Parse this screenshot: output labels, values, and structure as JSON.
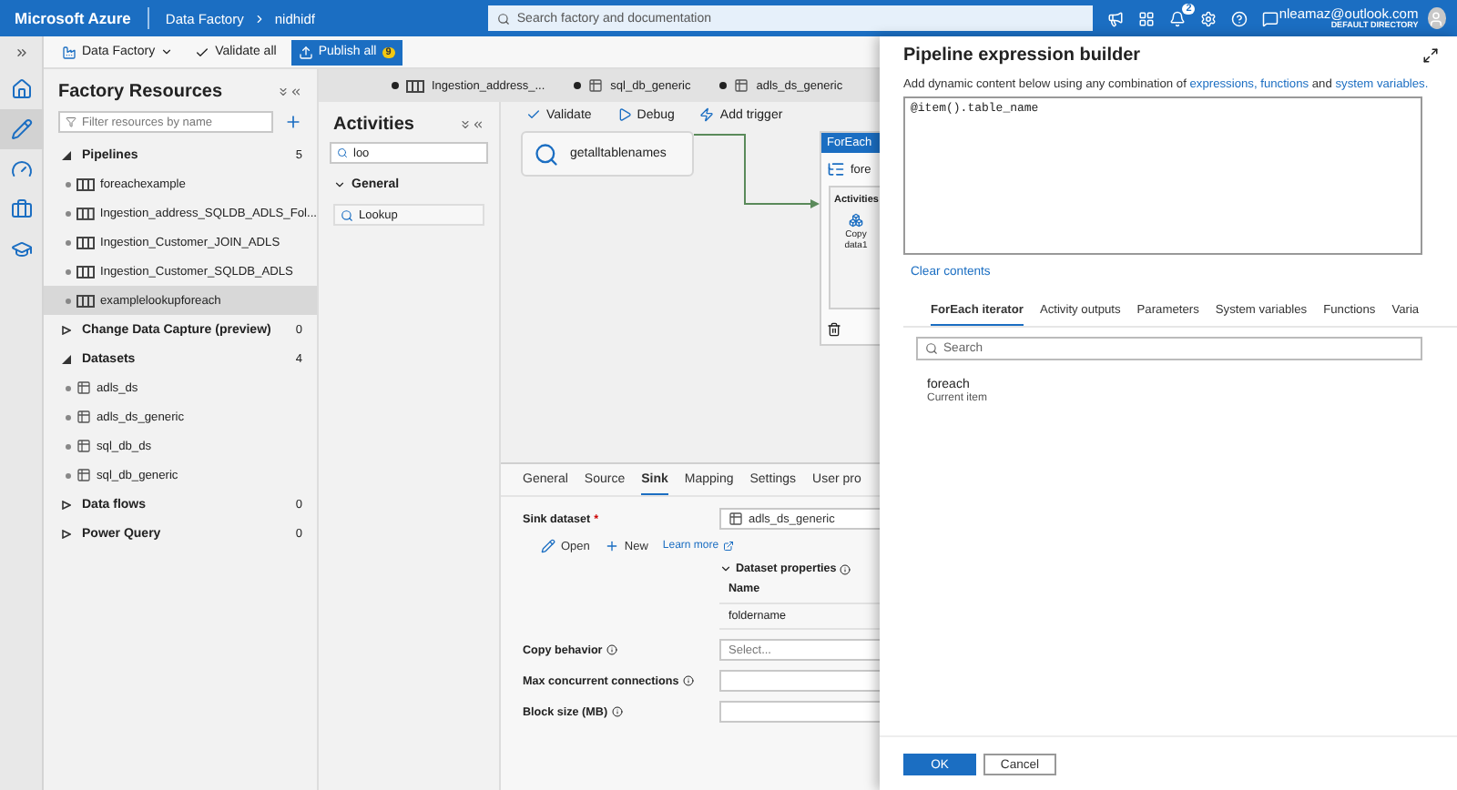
{
  "topbar": {
    "brand": "Microsoft Azure",
    "breadcrumb": [
      "Data Factory",
      "nidhidf"
    ],
    "search": {
      "placeholder": "Search factory and documentation"
    },
    "notification_count": "2",
    "user": {
      "email": "nleamaz@outlook.com",
      "directory": "DEFAULT DIRECTORY"
    }
  },
  "rail": [
    {
      "kind": "home",
      "selected": false
    },
    {
      "kind": "author",
      "selected": true
    },
    {
      "kind": "monitor",
      "selected": false
    },
    {
      "kind": "manage",
      "selected": false
    },
    {
      "kind": "learn",
      "selected": false
    }
  ],
  "toolbar": {
    "factory": "Data Factory",
    "validate_all": "Validate all",
    "publish_all": "Publish all",
    "publish_count": "9"
  },
  "factory_resources": {
    "title": "Factory Resources",
    "filter": {
      "placeholder": "Filter resources by name"
    },
    "sections": [
      {
        "label": "Pipelines",
        "count": "5",
        "expanded": true,
        "kind": "pipeline",
        "items": [
          {
            "label": "foreachexample",
            "selected": false
          },
          {
            "label": "Ingestion_address_SQLDB_ADLS_Fol...",
            "selected": false
          },
          {
            "label": "Ingestion_Customer_JOIN_ADLS",
            "selected": false
          },
          {
            "label": "Ingestion_Customer_SQLDB_ADLS",
            "selected": false
          },
          {
            "label": "examplelookupforeach",
            "selected": true
          }
        ]
      },
      {
        "label": "Change Data Capture (preview)",
        "count": "0",
        "expanded": false
      },
      {
        "label": "Datasets",
        "count": "4",
        "expanded": true,
        "kind": "dataset",
        "items": [
          {
            "label": "adls_ds",
            "selected": false
          },
          {
            "label": "adls_ds_generic",
            "selected": false
          },
          {
            "label": "sql_db_ds",
            "selected": false
          },
          {
            "label": "sql_db_generic",
            "selected": false
          }
        ]
      },
      {
        "label": "Data flows",
        "count": "0",
        "expanded": false
      },
      {
        "label": "Power Query",
        "count": "0",
        "expanded": false
      }
    ]
  },
  "document_tabs": [
    {
      "label": "Ingestion_address_...",
      "kind": "pipeline",
      "unsaved": true
    },
    {
      "label": "sql_db_generic",
      "kind": "dataset",
      "unsaved": true
    },
    {
      "label": "adls_ds_generic",
      "kind": "dataset",
      "unsaved": true
    }
  ],
  "activities": {
    "title": "Activities",
    "search": {
      "value": "loo"
    },
    "group": {
      "label": "General",
      "expanded": true
    },
    "items": [
      "Lookup"
    ]
  },
  "canvas": {
    "toolbar": [
      "Validate",
      "Debug",
      "Add trigger"
    ],
    "lookup_node": {
      "label": "getalltablenames"
    },
    "foreach_node": {
      "title": "ForEach",
      "label": "fore",
      "activities_label": "Activities",
      "inner_activity": "Copy data1"
    }
  },
  "properties": {
    "tabs": [
      {
        "label": "General",
        "selected": false
      },
      {
        "label": "Source",
        "selected": false
      },
      {
        "label": "Sink",
        "selected": true
      },
      {
        "label": "Mapping",
        "selected": false
      },
      {
        "label": "Settings",
        "selected": false
      },
      {
        "label": "User pro",
        "selected": false
      }
    ],
    "sink_dataset": {
      "label": "Sink dataset",
      "required_mark": "*",
      "value": "adls_ds_generic"
    },
    "actions": [
      "Open",
      "New"
    ],
    "learn_more": "Learn more",
    "dataset_properties": {
      "title": "Dataset properties",
      "expanded": true,
      "column": "Name",
      "rows": [
        "foldername"
      ]
    },
    "fields": [
      {
        "label": "Copy behavior",
        "kind": "select",
        "placeholder": "Select..."
      },
      {
        "label": "Max concurrent connections",
        "kind": "input"
      },
      {
        "label": "Block size (MB)",
        "kind": "input"
      }
    ]
  },
  "expression_builder": {
    "title": "Pipeline expression builder",
    "description": "Add dynamic content below using any combination of",
    "links": [
      "expressions,",
      "functions",
      "system variables."
    ],
    "conjunction": "and",
    "expression": "@item().table_name",
    "clear": "Clear contents",
    "tabs": [
      {
        "label": "ForEach iterator",
        "selected": true
      },
      {
        "label": "Activity outputs",
        "selected": false
      },
      {
        "label": "Parameters",
        "selected": false
      },
      {
        "label": "System variables",
        "selected": false
      },
      {
        "label": "Functions",
        "selected": false
      },
      {
        "label": "Varia",
        "selected": false
      }
    ],
    "search": {
      "placeholder": "Search"
    },
    "items": [
      {
        "name": "foreach",
        "description": "Current item"
      }
    ],
    "buttons": [
      "OK",
      "Cancel"
    ]
  }
}
